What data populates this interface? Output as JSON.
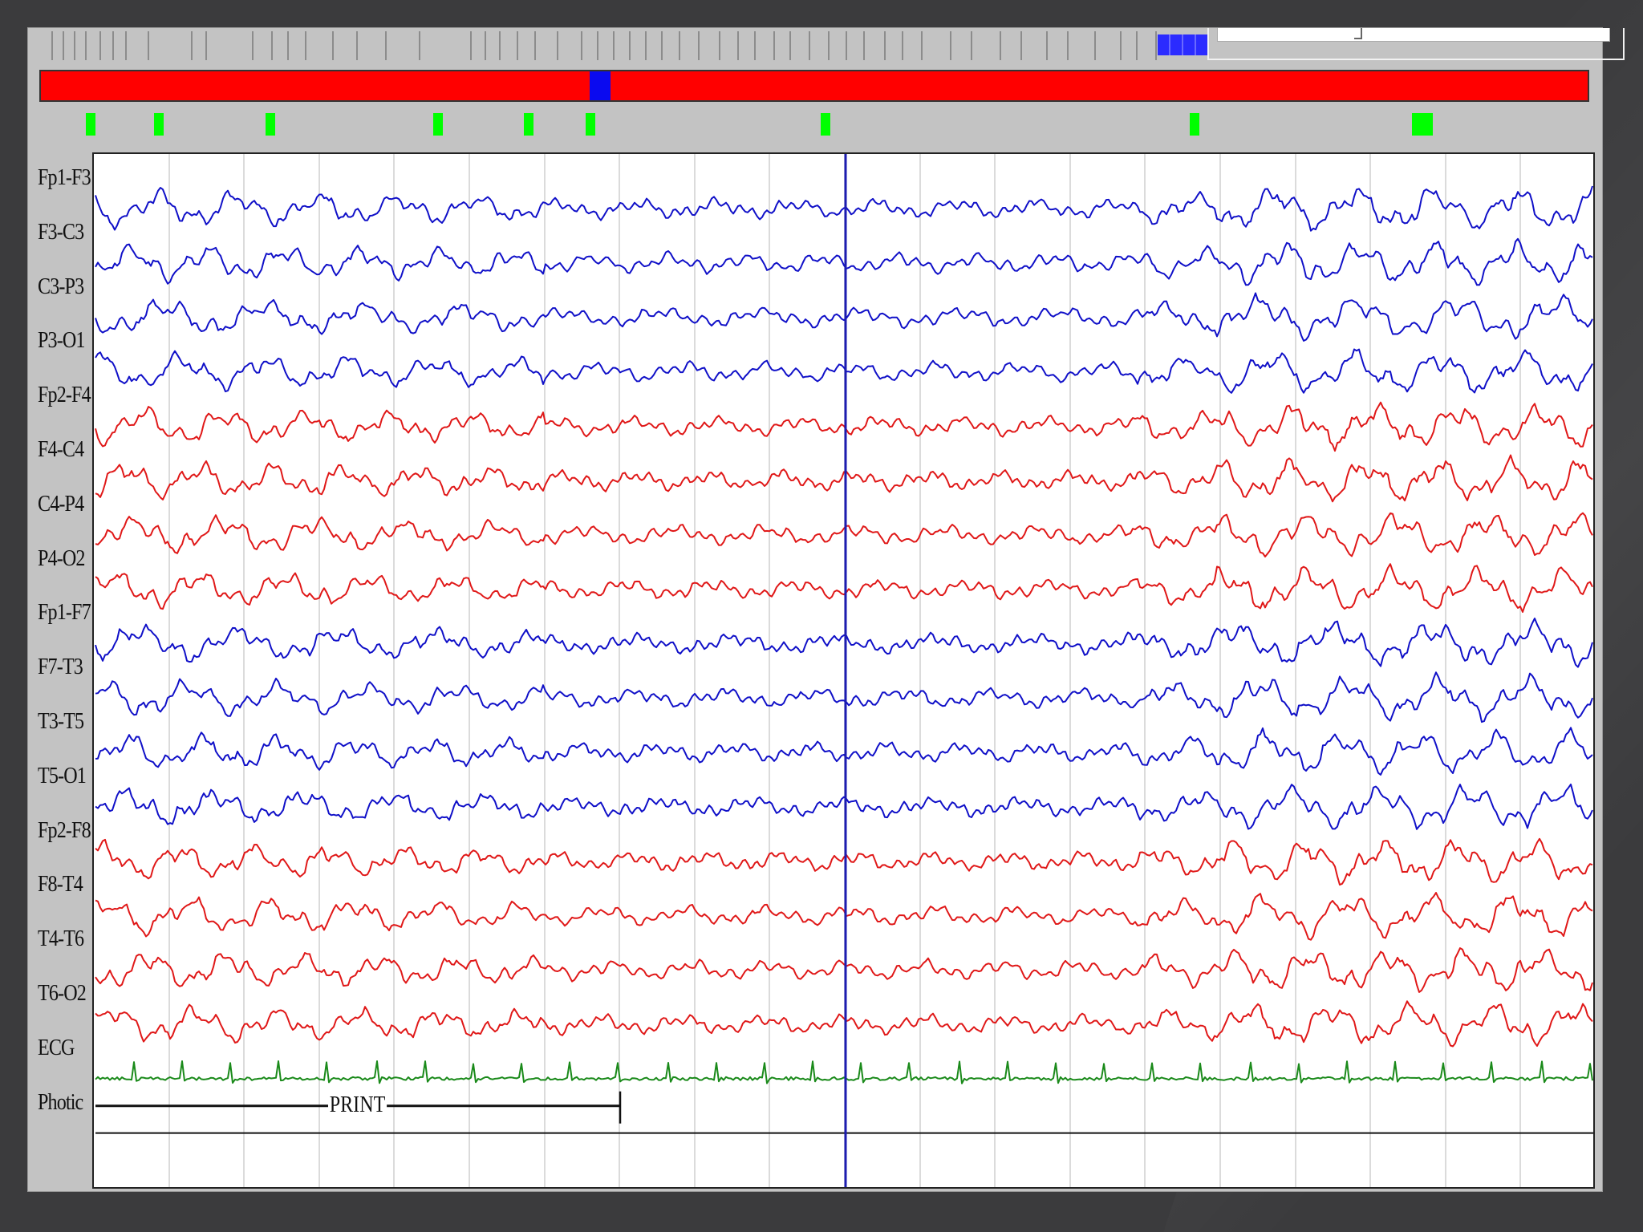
{
  "window": {
    "timeline_marker_color": "#0a0af0",
    "timeline_color": "#ff0000",
    "event_marker_color": "#00ff00"
  },
  "channels": [
    {
      "label": "Fp1-F3",
      "color": "#1010c8"
    },
    {
      "label": "F3-C3",
      "color": "#1010c8"
    },
    {
      "label": "C3-P3",
      "color": "#1010c8"
    },
    {
      "label": "P3-O1",
      "color": "#1010c8"
    },
    {
      "label": "Fp2-F4",
      "color": "#e01818"
    },
    {
      "label": "F4-C4",
      "color": "#e01818"
    },
    {
      "label": "C4-P4",
      "color": "#e01818"
    },
    {
      "label": "P4-O2",
      "color": "#e01818"
    },
    {
      "label": "Fp1-F7",
      "color": "#1010c8"
    },
    {
      "label": "F7-T3",
      "color": "#1010c8"
    },
    {
      "label": "T3-T5",
      "color": "#1010c8"
    },
    {
      "label": "T5-O1",
      "color": "#1010c8"
    },
    {
      "label": "Fp2-F8",
      "color": "#e01818"
    },
    {
      "label": "F8-T4",
      "color": "#e01818"
    },
    {
      "label": "T4-T6",
      "color": "#e01818"
    },
    {
      "label": "T6-O2",
      "color": "#e01818"
    },
    {
      "label": "ECG",
      "color": "#1a8a1a"
    },
    {
      "label": "Photic",
      "color": "#111111"
    }
  ],
  "annotation": {
    "print_label": "PRINT"
  },
  "cursor_color": "#1c1cb0"
}
